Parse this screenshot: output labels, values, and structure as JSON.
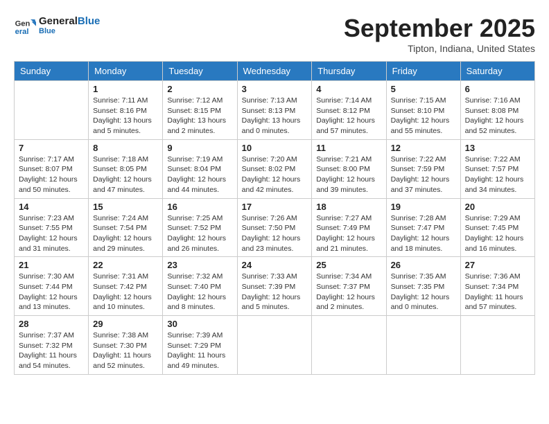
{
  "logo": {
    "text_general": "General",
    "text_blue": "Blue"
  },
  "title": "September 2025",
  "location": "Tipton, Indiana, United States",
  "days_of_week": [
    "Sunday",
    "Monday",
    "Tuesday",
    "Wednesday",
    "Thursday",
    "Friday",
    "Saturday"
  ],
  "weeks": [
    [
      {
        "day": "",
        "info": ""
      },
      {
        "day": "1",
        "info": "Sunrise: 7:11 AM\nSunset: 8:16 PM\nDaylight: 13 hours\nand 5 minutes."
      },
      {
        "day": "2",
        "info": "Sunrise: 7:12 AM\nSunset: 8:15 PM\nDaylight: 13 hours\nand 2 minutes."
      },
      {
        "day": "3",
        "info": "Sunrise: 7:13 AM\nSunset: 8:13 PM\nDaylight: 13 hours\nand 0 minutes."
      },
      {
        "day": "4",
        "info": "Sunrise: 7:14 AM\nSunset: 8:12 PM\nDaylight: 12 hours\nand 57 minutes."
      },
      {
        "day": "5",
        "info": "Sunrise: 7:15 AM\nSunset: 8:10 PM\nDaylight: 12 hours\nand 55 minutes."
      },
      {
        "day": "6",
        "info": "Sunrise: 7:16 AM\nSunset: 8:08 PM\nDaylight: 12 hours\nand 52 minutes."
      }
    ],
    [
      {
        "day": "7",
        "info": "Sunrise: 7:17 AM\nSunset: 8:07 PM\nDaylight: 12 hours\nand 50 minutes."
      },
      {
        "day": "8",
        "info": "Sunrise: 7:18 AM\nSunset: 8:05 PM\nDaylight: 12 hours\nand 47 minutes."
      },
      {
        "day": "9",
        "info": "Sunrise: 7:19 AM\nSunset: 8:04 PM\nDaylight: 12 hours\nand 44 minutes."
      },
      {
        "day": "10",
        "info": "Sunrise: 7:20 AM\nSunset: 8:02 PM\nDaylight: 12 hours\nand 42 minutes."
      },
      {
        "day": "11",
        "info": "Sunrise: 7:21 AM\nSunset: 8:00 PM\nDaylight: 12 hours\nand 39 minutes."
      },
      {
        "day": "12",
        "info": "Sunrise: 7:22 AM\nSunset: 7:59 PM\nDaylight: 12 hours\nand 37 minutes."
      },
      {
        "day": "13",
        "info": "Sunrise: 7:22 AM\nSunset: 7:57 PM\nDaylight: 12 hours\nand 34 minutes."
      }
    ],
    [
      {
        "day": "14",
        "info": "Sunrise: 7:23 AM\nSunset: 7:55 PM\nDaylight: 12 hours\nand 31 minutes."
      },
      {
        "day": "15",
        "info": "Sunrise: 7:24 AM\nSunset: 7:54 PM\nDaylight: 12 hours\nand 29 minutes."
      },
      {
        "day": "16",
        "info": "Sunrise: 7:25 AM\nSunset: 7:52 PM\nDaylight: 12 hours\nand 26 minutes."
      },
      {
        "day": "17",
        "info": "Sunrise: 7:26 AM\nSunset: 7:50 PM\nDaylight: 12 hours\nand 23 minutes."
      },
      {
        "day": "18",
        "info": "Sunrise: 7:27 AM\nSunset: 7:49 PM\nDaylight: 12 hours\nand 21 minutes."
      },
      {
        "day": "19",
        "info": "Sunrise: 7:28 AM\nSunset: 7:47 PM\nDaylight: 12 hours\nand 18 minutes."
      },
      {
        "day": "20",
        "info": "Sunrise: 7:29 AM\nSunset: 7:45 PM\nDaylight: 12 hours\nand 16 minutes."
      }
    ],
    [
      {
        "day": "21",
        "info": "Sunrise: 7:30 AM\nSunset: 7:44 PM\nDaylight: 12 hours\nand 13 minutes."
      },
      {
        "day": "22",
        "info": "Sunrise: 7:31 AM\nSunset: 7:42 PM\nDaylight: 12 hours\nand 10 minutes."
      },
      {
        "day": "23",
        "info": "Sunrise: 7:32 AM\nSunset: 7:40 PM\nDaylight: 12 hours\nand 8 minutes."
      },
      {
        "day": "24",
        "info": "Sunrise: 7:33 AM\nSunset: 7:39 PM\nDaylight: 12 hours\nand 5 minutes."
      },
      {
        "day": "25",
        "info": "Sunrise: 7:34 AM\nSunset: 7:37 PM\nDaylight: 12 hours\nand 2 minutes."
      },
      {
        "day": "26",
        "info": "Sunrise: 7:35 AM\nSunset: 7:35 PM\nDaylight: 12 hours\nand 0 minutes."
      },
      {
        "day": "27",
        "info": "Sunrise: 7:36 AM\nSunset: 7:34 PM\nDaylight: 11 hours\nand 57 minutes."
      }
    ],
    [
      {
        "day": "28",
        "info": "Sunrise: 7:37 AM\nSunset: 7:32 PM\nDaylight: 11 hours\nand 54 minutes."
      },
      {
        "day": "29",
        "info": "Sunrise: 7:38 AM\nSunset: 7:30 PM\nDaylight: 11 hours\nand 52 minutes."
      },
      {
        "day": "30",
        "info": "Sunrise: 7:39 AM\nSunset: 7:29 PM\nDaylight: 11 hours\nand 49 minutes."
      },
      {
        "day": "",
        "info": ""
      },
      {
        "day": "",
        "info": ""
      },
      {
        "day": "",
        "info": ""
      },
      {
        "day": "",
        "info": ""
      }
    ]
  ]
}
